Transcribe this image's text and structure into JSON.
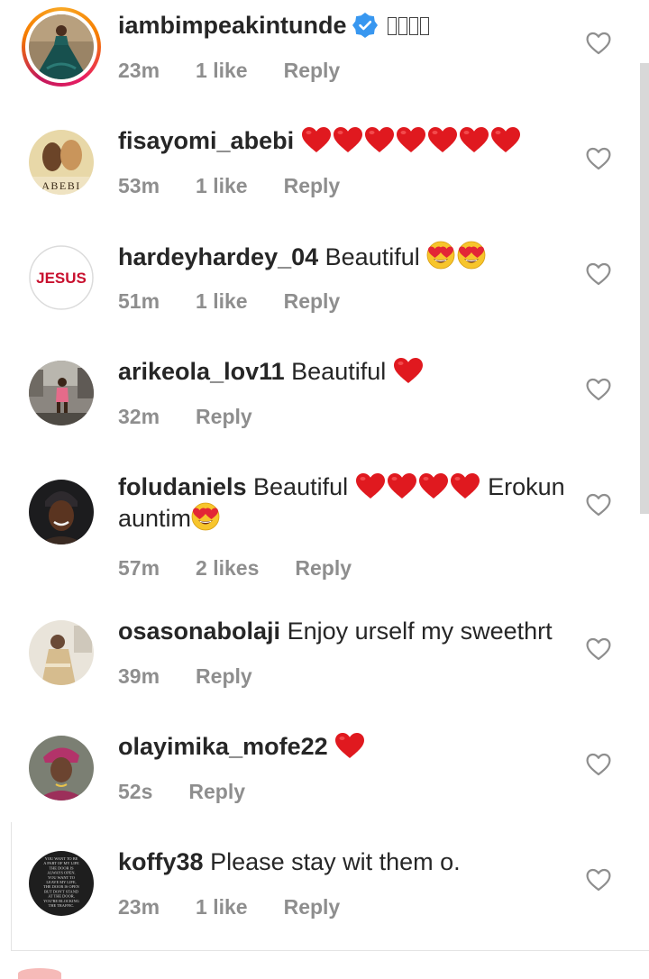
{
  "comments": [
    {
      "username": "iambimpeakintunde",
      "verified": true,
      "text": "",
      "boxes": 4,
      "time": "23m",
      "likes": "1 like",
      "reply": "Reply",
      "avatar_icon": "woman-teal-gown-photo",
      "story_ring": true
    },
    {
      "username": "fisayomi_abebi",
      "text": "",
      "hearts": 7,
      "time": "53m",
      "likes": "1 like",
      "reply": "Reply",
      "avatar_icon": "abebi-poster",
      "avatar_text": "ABEBI"
    },
    {
      "username": "hardeyhardey_04",
      "text": "Beautiful",
      "eyes": 2,
      "time": "51m",
      "likes": "1 like",
      "reply": "Reply",
      "avatar_icon": "jesus-text-logo",
      "avatar_text": "JESUS"
    },
    {
      "username": "arikeola_lov11",
      "text": "Beautiful",
      "hearts": 1,
      "time": "32m",
      "likes": "",
      "reply": "Reply",
      "avatar_icon": "girl-outdoor-photo"
    },
    {
      "username": "foludaniels",
      "text": "Beautiful",
      "hearts": 4,
      "text_after": "Erokun",
      "line2": "auntim",
      "time": "57m",
      "likes": "2 likes",
      "reply": "Reply",
      "avatar_icon": "woman-headwrap-photo"
    },
    {
      "username": "osasonabolaji",
      "text": "Enjoy urself my sweethrt",
      "time": "39m",
      "likes": "",
      "reply": "Reply",
      "avatar_icon": "woman-event-photo"
    },
    {
      "username": "olayimika_mofe22",
      "text": "",
      "hearts": 1,
      "time": "52s",
      "likes": "",
      "reply": "Reply",
      "avatar_icon": "woman-gele-photo"
    },
    {
      "username": "koffy38",
      "text": "Please stay wit them o.",
      "time": "23m",
      "likes": "1 like",
      "reply": "Reply",
      "avatar_icon": "quote-text-image",
      "avatar_quote": [
        "YOU WANT TO BE",
        "A PART OF MY LIFE",
        "THE DOOR IS",
        "ALWAYS OPEN.",
        "YOU WANT TO",
        "LEAVE MY LIFE,",
        "THE DOOR IS OPEN",
        "BUT DON'T STAND",
        "AT THE DOOR,",
        "YOU'RE BLOCKING",
        "THE TRAFFIC."
      ]
    }
  ],
  "icons": {
    "like": "heart-outline-icon",
    "verified": "verified-badge-icon",
    "heart_emoji": "red-heart-emoji",
    "eyes_emoji": "heart-eyes-emoji"
  },
  "colors": {
    "text": "#262626",
    "meta": "#8e8e8e",
    "verified": "#3897f0",
    "heart": "#e0191f",
    "emoji_face": "#f7c52c"
  }
}
